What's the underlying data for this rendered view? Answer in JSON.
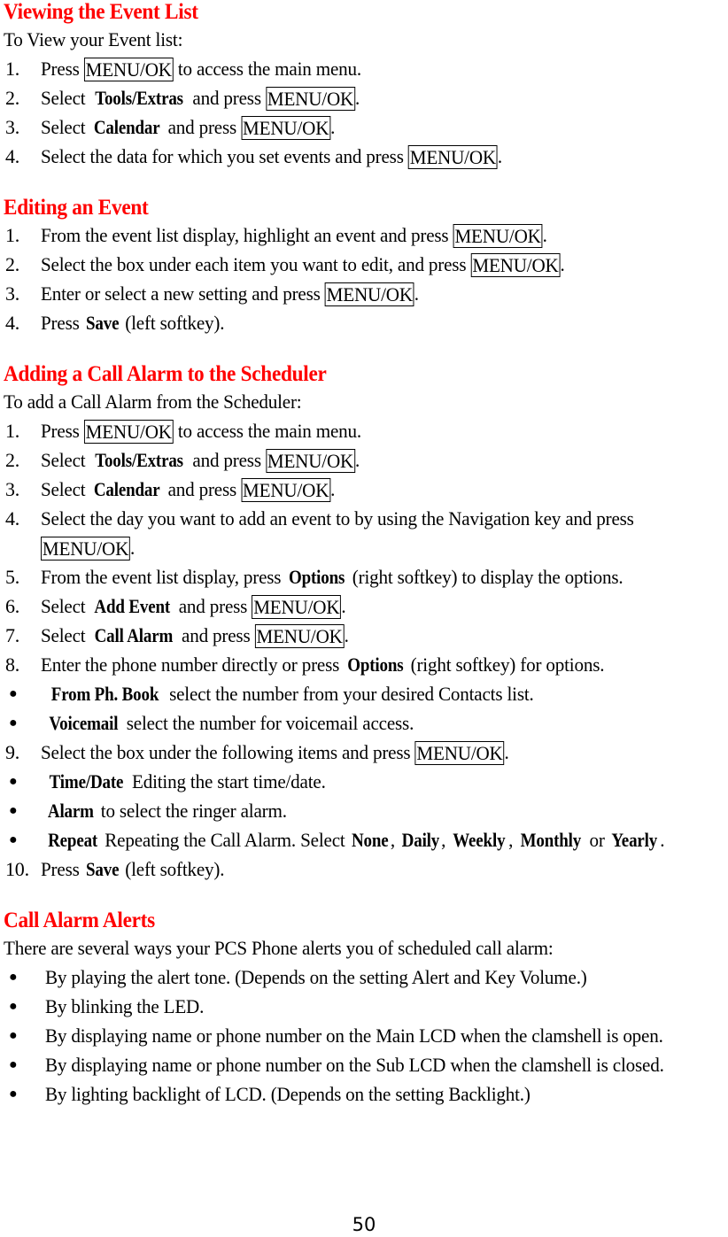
{
  "document": {
    "page_number": "50",
    "heading_color": "#ff0000",
    "text_color": "#000000",
    "background_color": "#ffffff"
  },
  "sections": [
    {
      "heading": "Viewing the Event List",
      "intro": "To View your Event list:",
      "steps": [
        {
          "num": "1.",
          "parts": [
            {
              "t": "text",
              "v": "Press "
            },
            {
              "t": "key",
              "v": "MENU/OK"
            },
            {
              "t": "text",
              "v": " to access the main menu."
            }
          ]
        },
        {
          "num": "2.",
          "parts": [
            {
              "t": "text",
              "v": "Select "
            },
            {
              "t": "bold",
              "v": "Tools/Extras"
            },
            {
              "t": "text",
              "v": " and press "
            },
            {
              "t": "key",
              "v": "MENU/OK"
            },
            {
              "t": "text",
              "v": "."
            }
          ]
        },
        {
          "num": "3.",
          "parts": [
            {
              "t": "text",
              "v": "Select "
            },
            {
              "t": "bold",
              "v": "Calendar"
            },
            {
              "t": "text",
              "v": " and press "
            },
            {
              "t": "key",
              "v": "MENU/OK"
            },
            {
              "t": "text",
              "v": "."
            }
          ]
        },
        {
          "num": "4.",
          "parts": [
            {
              "t": "text",
              "v": "Select the data for which you set events and press "
            },
            {
              "t": "key",
              "v": "MENU/OK"
            },
            {
              "t": "text",
              "v": "."
            }
          ]
        }
      ]
    },
    {
      "heading": "Editing an Event",
      "intro": null,
      "steps": [
        {
          "num": "1.",
          "parts": [
            {
              "t": "text",
              "v": "From the event list display, highlight an event and press "
            },
            {
              "t": "key",
              "v": "MENU/OK"
            },
            {
              "t": "text",
              "v": "."
            }
          ]
        },
        {
          "num": "2.",
          "parts": [
            {
              "t": "text",
              "v": "Select the box under each item you want to edit, and press "
            },
            {
              "t": "key",
              "v": "MENU/OK"
            },
            {
              "t": "text",
              "v": "."
            }
          ]
        },
        {
          "num": "3.",
          "parts": [
            {
              "t": "text",
              "v": "Enter or select a new setting and press "
            },
            {
              "t": "key",
              "v": "MENU/OK"
            },
            {
              "t": "text",
              "v": "."
            }
          ]
        },
        {
          "num": "4.",
          "parts": [
            {
              "t": "text",
              "v": "Press "
            },
            {
              "t": "bold",
              "v": "Save"
            },
            {
              "t": "text",
              "v": " (left softkey)."
            }
          ]
        }
      ]
    },
    {
      "heading": "Adding a Call Alarm to the Scheduler",
      "intro": "To add a Call Alarm from the Scheduler:",
      "steps": [
        {
          "num": "1.",
          "parts": [
            {
              "t": "text",
              "v": "Press "
            },
            {
              "t": "key",
              "v": "MENU/OK"
            },
            {
              "t": "text",
              "v": " to access the main menu."
            }
          ]
        },
        {
          "num": "2.",
          "parts": [
            {
              "t": "text",
              "v": "Select "
            },
            {
              "t": "bold",
              "v": "Tools/Extras"
            },
            {
              "t": "text",
              "v": " and press "
            },
            {
              "t": "key",
              "v": "MENU/OK"
            },
            {
              "t": "text",
              "v": "."
            }
          ]
        },
        {
          "num": "3.",
          "parts": [
            {
              "t": "text",
              "v": "Select "
            },
            {
              "t": "bold",
              "v": "Calendar"
            },
            {
              "t": "text",
              "v": " and press "
            },
            {
              "t": "key",
              "v": "MENU/OK"
            },
            {
              "t": "text",
              "v": "."
            }
          ]
        },
        {
          "num": "4.",
          "parts": [
            {
              "t": "text",
              "v": "Select the day you want to add an event to by using the Navigation key and press"
            }
          ],
          "parts2": [
            {
              "t": "key",
              "v": "MENU/OK"
            },
            {
              "t": "text",
              "v": "."
            }
          ]
        },
        {
          "num": "5.",
          "parts": [
            {
              "t": "text",
              "v": "From the event list display, press "
            },
            {
              "t": "bold",
              "v": "Options"
            },
            {
              "t": "text",
              "v": " (right softkey) to display the options."
            }
          ]
        },
        {
          "num": "6.",
          "parts": [
            {
              "t": "text",
              "v": "Select "
            },
            {
              "t": "bold",
              "v": "Add Event"
            },
            {
              "t": "text",
              "v": " and press "
            },
            {
              "t": "key",
              "v": "MENU/OK"
            },
            {
              "t": "text",
              "v": "."
            }
          ]
        },
        {
          "num": "7.",
          "parts": [
            {
              "t": "text",
              "v": "Select "
            },
            {
              "t": "bold",
              "v": "Call Alarm"
            },
            {
              "t": "text",
              "v": " and press "
            },
            {
              "t": "key",
              "v": "MENU/OK"
            },
            {
              "t": "text",
              "v": "."
            }
          ]
        },
        {
          "num": "8.",
          "parts": [
            {
              "t": "text",
              "v": "Enter the phone number directly or press "
            },
            {
              "t": "bold",
              "v": "Options"
            },
            {
              "t": "text",
              "v": " (right softkey) for options."
            }
          ]
        },
        {
          "num": "●",
          "bullet": true,
          "parts": [
            {
              "t": "bold",
              "v": "From Ph. Book"
            },
            {
              "t": "text",
              "v": " select the number from your desired Contacts list."
            }
          ]
        },
        {
          "num": "●",
          "bullet": true,
          "parts": [
            {
              "t": "bold",
              "v": "Voicemail"
            },
            {
              "t": "text",
              "v": " select the number for voicemail access."
            }
          ]
        },
        {
          "num": "9.",
          "parts": [
            {
              "t": "text",
              "v": "Select the box under the following items and press "
            },
            {
              "t": "key",
              "v": "MENU/OK"
            },
            {
              "t": "text",
              "v": "."
            }
          ]
        },
        {
          "num": "●",
          "bullet": true,
          "parts": [
            {
              "t": "bold",
              "v": "Time/Date"
            },
            {
              "t": "text",
              "v": " Editing the start time/date."
            }
          ]
        },
        {
          "num": "●",
          "bullet": true,
          "parts": [
            {
              "t": "bold",
              "v": "Alarm"
            },
            {
              "t": "text",
              "v": " to select the ringer alarm."
            }
          ]
        },
        {
          "num": "●",
          "bullet": true,
          "parts": [
            {
              "t": "bold",
              "v": "Repeat"
            },
            {
              "t": "text",
              "v": " Repeating the Call Alarm. Select "
            },
            {
              "t": "bold",
              "v": "None"
            },
            {
              "t": "text",
              "v": ", "
            },
            {
              "t": "bold",
              "v": "Daily"
            },
            {
              "t": "text",
              "v": ", "
            },
            {
              "t": "bold",
              "v": "Weekly"
            },
            {
              "t": "text",
              "v": ", "
            },
            {
              "t": "bold",
              "v": "Monthly"
            },
            {
              "t": "text",
              "v": " or "
            },
            {
              "t": "bold",
              "v": "Yearly"
            },
            {
              "t": "text",
              "v": "."
            }
          ]
        },
        {
          "num": "10.",
          "parts": [
            {
              "t": "text",
              "v": "Press "
            },
            {
              "t": "bold",
              "v": "Save"
            },
            {
              "t": "text",
              "v": " (left softkey)."
            }
          ]
        }
      ]
    },
    {
      "heading": "Call Alarm Alerts",
      "intro": "There are several ways your PCS Phone alerts you of scheduled call alarm:",
      "steps": [
        {
          "num": "●",
          "bullet": true,
          "parts": [
            {
              "t": "text",
              "v": "By playing the alert tone. (Depends on the setting Alert and Key Volume.)"
            }
          ]
        },
        {
          "num": "●",
          "bullet": true,
          "parts": [
            {
              "t": "text",
              "v": "By blinking the LED."
            }
          ]
        },
        {
          "num": "●",
          "bullet": true,
          "parts": [
            {
              "t": "text",
              "v": "By displaying name or phone number on the Main LCD when the clamshell is open."
            }
          ]
        },
        {
          "num": "●",
          "bullet": true,
          "parts": [
            {
              "t": "text",
              "v": "By displaying name or phone number on the Sub LCD when the clamshell is closed."
            }
          ]
        },
        {
          "num": "●",
          "bullet": true,
          "parts": [
            {
              "t": "text",
              "v": "By lighting backlight of LCD. (Depends on the setting Backlight.)"
            }
          ]
        }
      ]
    }
  ]
}
